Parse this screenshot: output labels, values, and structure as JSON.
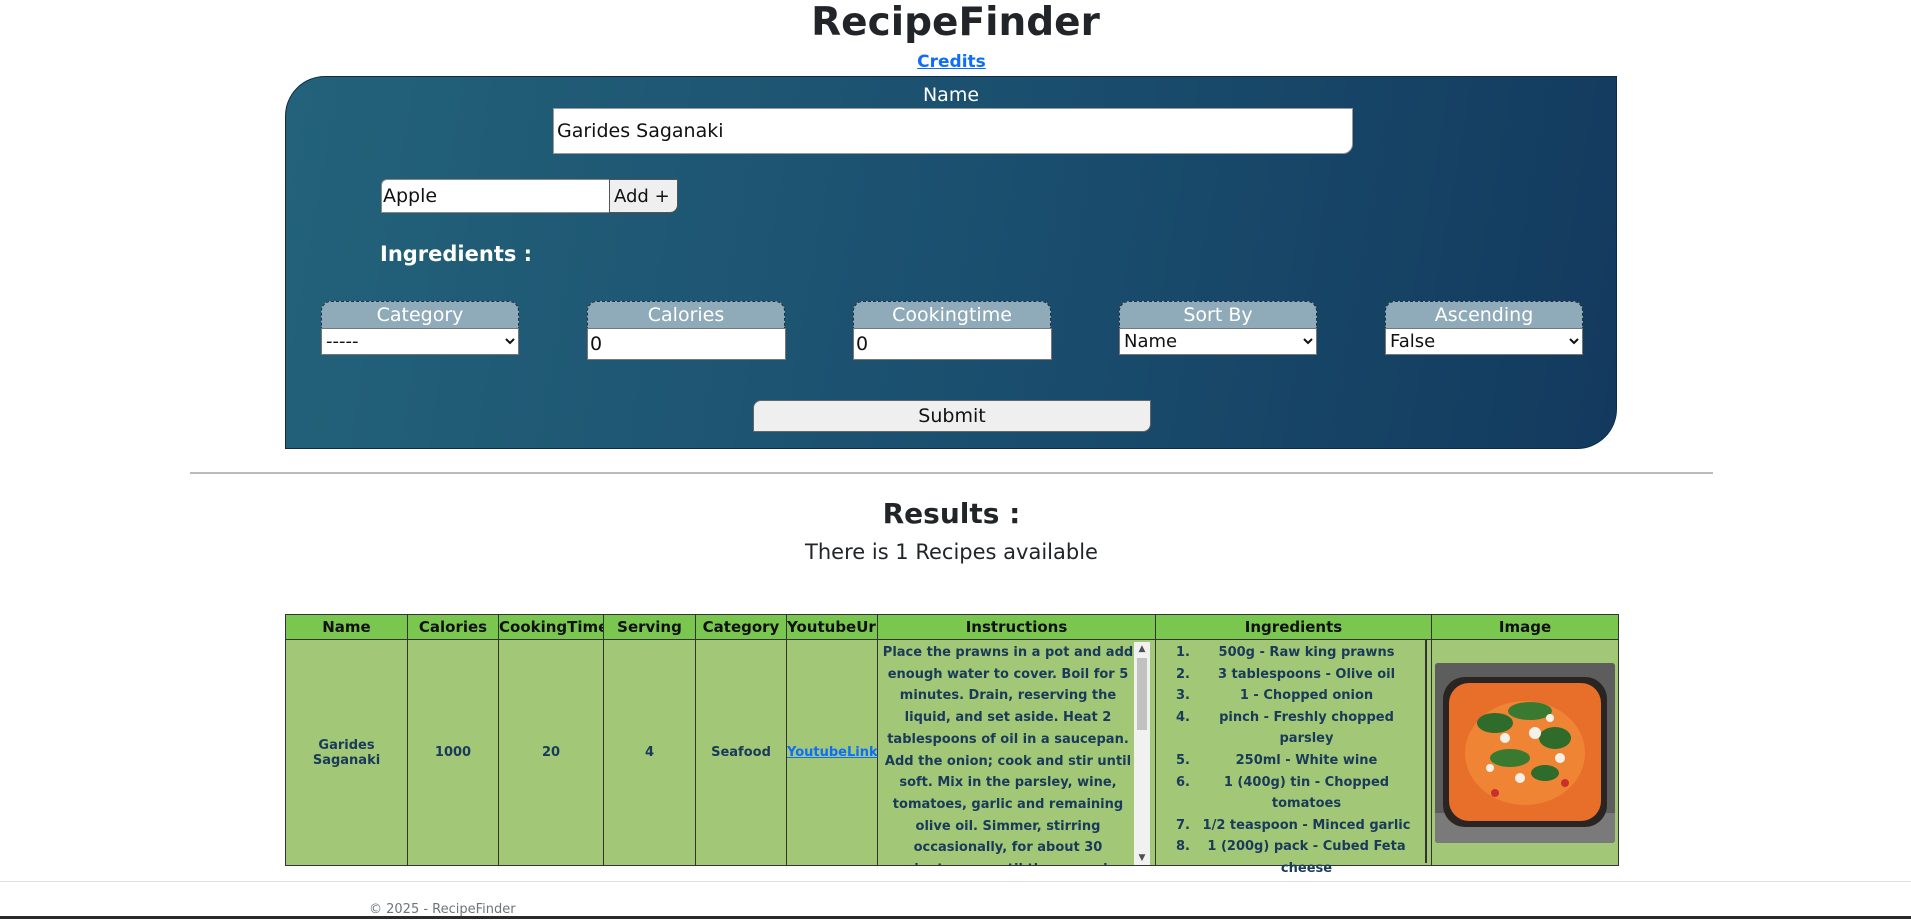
{
  "header": {
    "title": "RecipeFinder",
    "credits_label": "Credits"
  },
  "form": {
    "name_label": "Name",
    "name_value": "Garides Saganaki",
    "ingredient_value": "Apple",
    "add_label": "Add +",
    "ingredients_heading": "Ingredients :",
    "filters": {
      "category": {
        "label": "Category",
        "value": "-----"
      },
      "calories": {
        "label": "Calories",
        "value": "0"
      },
      "cookingtime": {
        "label": "Cookingtime",
        "value": "0"
      },
      "sort_by": {
        "label": "Sort By",
        "value": "Name"
      },
      "ascending": {
        "label": "Ascending",
        "value": "False"
      }
    },
    "submit_label": "Submit"
  },
  "results": {
    "heading": "Results :",
    "count_text": "There is 1 Recipes available",
    "columns": [
      "Name",
      "Calories",
      "CookingTime",
      "Serving",
      "Category",
      "YoutubeUrl",
      "Instructions",
      "Ingredients",
      "Image"
    ],
    "rows": [
      {
        "name": "Garides Saganaki",
        "calories": "1000",
        "cooking_time": "20",
        "serving": "4",
        "category": "Seafood",
        "youtube_label": "YoutubeLink",
        "instructions": "Place the prawns in a pot and add enough water to cover. Boil for 5 minutes. Drain, reserving the liquid, and set aside. Heat 2 tablespoons of oil in a saucepan. Add the onion; cook and stir until soft. Mix in the parsley, wine, tomatoes, garlic and remaining olive oil. Simmer, stirring occasionally, for about 30 minutes, or until the sauce is thickened. While the prawns in a pot ...",
        "ingredients": [
          {
            "num": "1.",
            "text": "500g - Raw king prawns"
          },
          {
            "num": "2.",
            "text": "3 tablespoons - Olive oil"
          },
          {
            "num": "3.",
            "text": "1 - Chopped onion"
          },
          {
            "num": "4.",
            "text": "pinch - Freshly chopped parsley"
          },
          {
            "num": "5.",
            "text": "250ml - White wine"
          },
          {
            "num": "6.",
            "text": "1 (400g) tin - Chopped tomatoes"
          },
          {
            "num": "7.",
            "text": "1/2 teaspoon - Minced garlic"
          },
          {
            "num": "8.",
            "text": "1 (200g) pack - Cubed Feta cheese"
          }
        ]
      }
    ]
  },
  "footer": {
    "text": "© 2025 - RecipeFinder"
  }
}
